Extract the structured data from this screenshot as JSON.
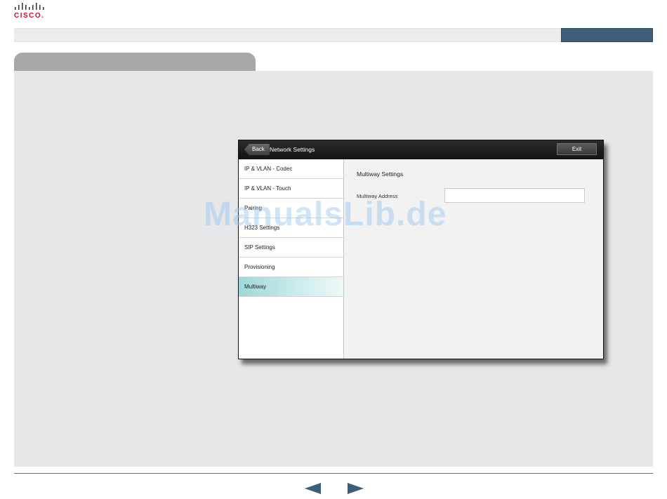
{
  "brand": {
    "logo_text": "CISCO.",
    "accent": "#c8102e"
  },
  "window": {
    "back_label": "Back",
    "title": "Network Settings",
    "exit_label": "Exit"
  },
  "sidebar": {
    "items": [
      {
        "label": "IP & VLAN - Codec"
      },
      {
        "label": "IP & VLAN - Touch"
      },
      {
        "label": "Pairing"
      },
      {
        "label": "H323 Settings"
      },
      {
        "label": "SIP Settings"
      },
      {
        "label": "Provisioning"
      },
      {
        "label": "Multiway",
        "active": true
      }
    ],
    "active_color": "#9fd8d6"
  },
  "main": {
    "section_title": "Multiway Settings",
    "field_label": "Multiway Address",
    "field_value": ""
  },
  "watermark": "ManualsLib.de",
  "nav": {
    "prev_icon": "left-triangle-icon",
    "next_icon": "right-triangle-icon",
    "arrow_color": "#3d5d78"
  }
}
